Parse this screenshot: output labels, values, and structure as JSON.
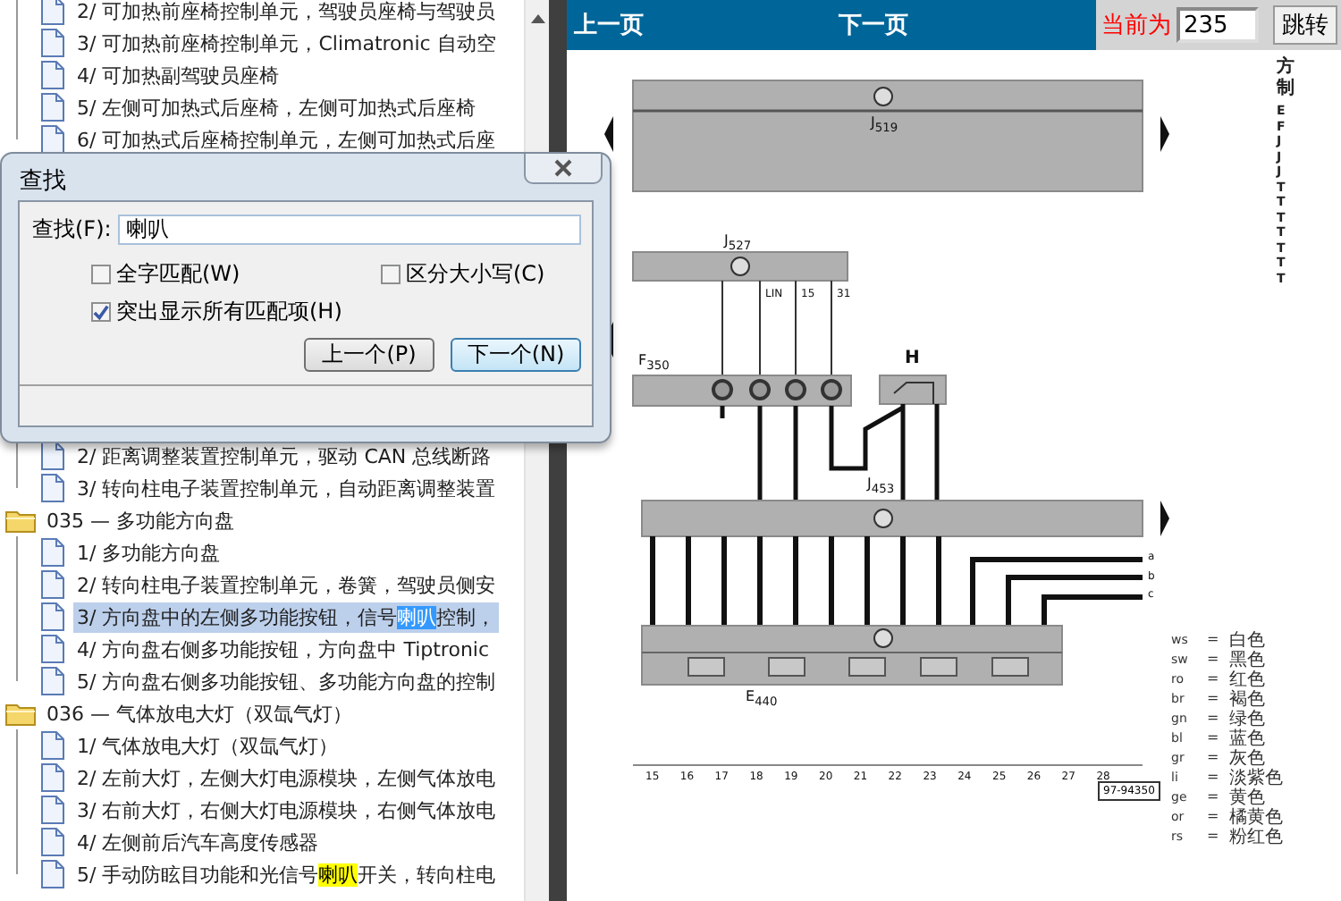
{
  "tree": [
    {
      "children": [
        {
          "label": "2/ 可加热前座椅控制单元，驾驶员座椅与驾驶员",
          "selected": false
        },
        {
          "label": "3/ 可加热前座椅控制单元，Climatronic 自动空",
          "selected": false
        },
        {
          "label": "4/ 可加热副驾驶员座椅",
          "selected": false
        },
        {
          "label": "5/ 左侧可加热式后座椅，左侧可加热式后座椅",
          "selected": false
        },
        {
          "label": "6/ 可加热式后座椅控制单元，左侧可加热式后座",
          "selected": false
        }
      ]
    },
    {
      "children": [
        {
          "label": "2/ 距离调整装置控制单元，驱动 CAN 总线断路",
          "selected": false
        },
        {
          "label": "3/ 转向柱电子装置控制单元，自动距离调整装置",
          "selected": false
        }
      ]
    },
    {
      "label": "035 — 多功能方向盘",
      "expanded": true,
      "children": [
        {
          "label": "1/ 多功能方向盘",
          "selected": false
        },
        {
          "label": "2/ 转向柱电子装置控制单元，卷簧，驾驶员侧安",
          "selected": false
        },
        {
          "segments": [
            {
              "text": "3/ 方向盘中的左侧多功能按钮，信号",
              "match": false
            },
            {
              "text": "喇叭",
              "match": true
            },
            {
              "text": "控制，",
              "match": false
            }
          ],
          "selected": true
        },
        {
          "label": "4/ 方向盘右侧多功能按钮，方向盘中 Tiptronic",
          "selected": false
        },
        {
          "label": "5/ 方向盘右侧多功能按钮、多功能方向盘的控制",
          "selected": false
        }
      ]
    },
    {
      "label": "036 — 气体放电大灯（双氙气灯）",
      "expanded": true,
      "children": [
        {
          "label": "1/ 气体放电大灯（双氙气灯）",
          "selected": false
        },
        {
          "label": "2/ 左前大灯，左侧大灯电源模块，左侧气体放电",
          "selected": false
        },
        {
          "label": "3/ 右前大灯，右侧大灯电源模块，右侧气体放电",
          "selected": false
        },
        {
          "label": "4/ 左侧前后汽车高度传感器",
          "selected": false
        },
        {
          "segments": [
            {
              "text": "5/ 手动防眩目功能和光信号",
              "match": false
            },
            {
              "text": "喇叭",
              "match": true
            },
            {
              "text": "开关，转向柱电",
              "match": false
            }
          ],
          "selected": false
        }
      ]
    }
  ],
  "find_dialog": {
    "title": "查找",
    "find_label": "查找(F):",
    "find_value": "喇叭",
    "checkboxes": [
      {
        "label": "全字匹配(W)",
        "checked": false
      },
      {
        "label": "区分大小写(C)",
        "checked": false
      },
      {
        "label": "突出显示所有匹配项(H)",
        "checked": true
      }
    ],
    "buttons": [
      {
        "label": "上一个(P)",
        "focused": false
      },
      {
        "label": "下一个(N)",
        "focused": true
      }
    ]
  },
  "toolbar": {
    "prev": "上一页",
    "next": "下一页",
    "page_label": "当前为",
    "page_value": "235",
    "go": "跳转"
  },
  "diagram": {
    "labels": [
      "J$_{519}$",
      "J$_{527}$",
      "F$_{350}$",
      "H",
      "J$_{453}$",
      "E$_{440}$"
    ],
    "wire_labels": [
      "LIN",
      "15",
      "31"
    ],
    "line_ends": [
      "a",
      "b",
      "c"
    ],
    "scale": [
      "15",
      "16",
      "17",
      "18",
      "19",
      "20",
      "21",
      "22",
      "23",
      "24",
      "25",
      "26",
      "27",
      "28"
    ],
    "figure_code": "97-94350",
    "side_notes": [
      "方",
      "制",
      "E",
      "F",
      "J",
      "J",
      "J",
      "T",
      "T",
      "T",
      "T",
      "T",
      "T",
      "T"
    ],
    "legend": [
      {
        "code": "ws",
        "eq": "=",
        "name": "白色"
      },
      {
        "code": "sw",
        "eq": "=",
        "name": "黑色"
      },
      {
        "code": "ro",
        "eq": "=",
        "name": "红色"
      },
      {
        "code": "br",
        "eq": "=",
        "name": "褐色"
      },
      {
        "code": "gn",
        "eq": "=",
        "name": "绿色"
      },
      {
        "code": "bl",
        "eq": "=",
        "name": "蓝色"
      },
      {
        "code": "gr",
        "eq": "=",
        "name": "灰色"
      },
      {
        "code": "li",
        "eq": "=",
        "name": "淡紫色"
      },
      {
        "code": "ge",
        "eq": "=",
        "name": "黄色"
      },
      {
        "code": "or",
        "eq": "=",
        "name": "橘黄色"
      },
      {
        "code": "rs",
        "eq": "=",
        "name": "粉红色"
      }
    ]
  }
}
